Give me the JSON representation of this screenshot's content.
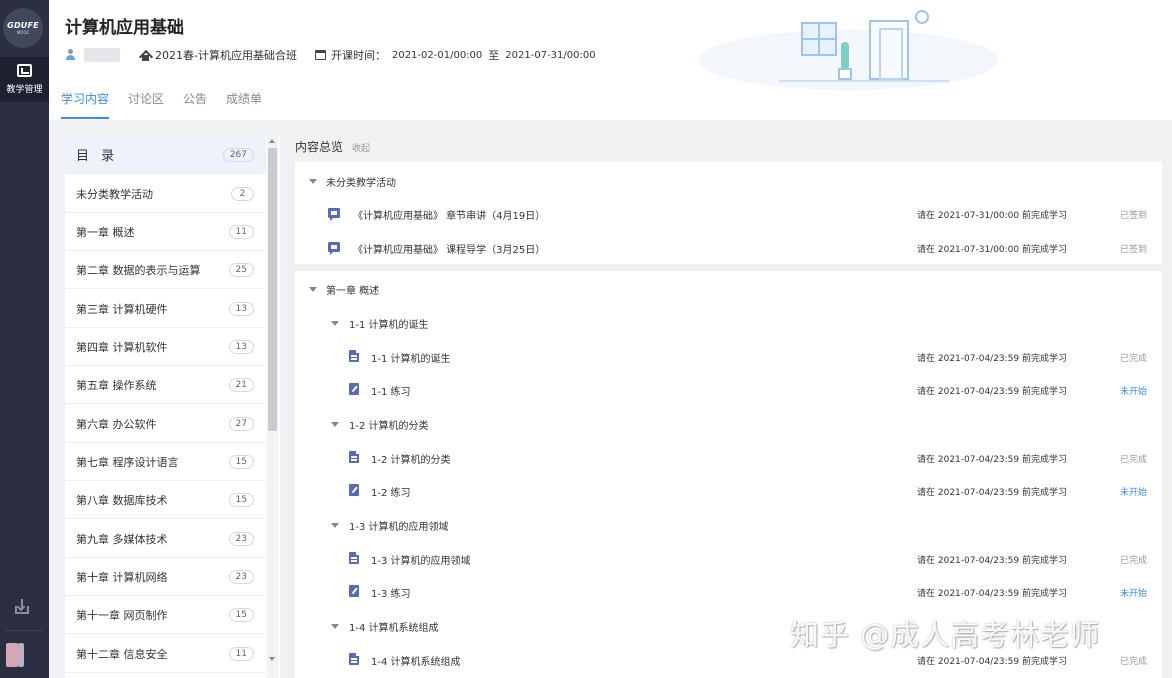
{
  "rail": {
    "logo_main": "GDUFE",
    "logo_sub": "MOOC",
    "active_label": "教学管理"
  },
  "header": {
    "course_title": "计算机应用基础",
    "class_name": "2021春-计算机应用基础合班",
    "time_label": "开课时间：",
    "start": "2021-02-01/00:00",
    "to": "至",
    "end": "2021-07-31/00:00"
  },
  "tabs": [
    {
      "label": "学习内容",
      "active": true
    },
    {
      "label": "讨论区"
    },
    {
      "label": "公告"
    },
    {
      "label": "成绩单"
    }
  ],
  "catalog": {
    "title": "目 录",
    "title_count": "267",
    "items": [
      {
        "name": "未分类教学活动",
        "count": "2"
      },
      {
        "name": "第一章 概述",
        "count": "11"
      },
      {
        "name": "第二章 数据的表示与运算",
        "count": "25"
      },
      {
        "name": "第三章 计算机硬件",
        "count": "13"
      },
      {
        "name": "第四章 计算机软件",
        "count": "13"
      },
      {
        "name": "第五章 操作系统",
        "count": "21"
      },
      {
        "name": "第六章 办公软件",
        "count": "27"
      },
      {
        "name": "第七章 程序设计语言",
        "count": "15"
      },
      {
        "name": "第八章 数据库技术",
        "count": "15"
      },
      {
        "name": "第九章 多媒体技术",
        "count": "23"
      },
      {
        "name": "第十章 计算机网络",
        "count": "23"
      },
      {
        "name": "第十一章 网页制作",
        "count": "15"
      },
      {
        "name": "第十二章 信息安全",
        "count": "11"
      }
    ]
  },
  "overview": {
    "title": "内容总览",
    "collapse": "收起"
  },
  "section_uncategorized": {
    "title": "未分类教学活动",
    "items": [
      {
        "icon": "chat",
        "title": "《计算机应用基础》 章节串讲（4月19日）",
        "deadline": "请在 2021-07-31/00:00 前完成学习",
        "status": "已签到"
      },
      {
        "icon": "chat",
        "title": "《计算机应用基础》 课程导学（3月25日）",
        "deadline": "请在 2021-07-31/00:00 前完成学习",
        "status": "已签到"
      }
    ]
  },
  "section_ch1": {
    "title": "第一章 概述",
    "subsections": [
      {
        "title": "1-1 计算机的诞生",
        "items": [
          {
            "icon": "doc",
            "title": "1-1 计算机的诞生",
            "deadline": "请在 2021-07-04/23:59 前完成学习",
            "status": "已完成"
          },
          {
            "icon": "edit",
            "title": "1-1 练习",
            "deadline": "请在 2021-07-04/23:59 前完成学习",
            "status": "未开始"
          }
        ]
      },
      {
        "title": "1-2 计算机的分类",
        "items": [
          {
            "icon": "doc",
            "title": "1-2 计算机的分类",
            "deadline": "请在 2021-07-04/23:59 前完成学习",
            "status": "已完成"
          },
          {
            "icon": "edit",
            "title": "1-2 练习",
            "deadline": "请在 2021-07-04/23:59 前完成学习",
            "status": "未开始"
          }
        ]
      },
      {
        "title": "1-3 计算机的应用领域",
        "items": [
          {
            "icon": "doc",
            "title": "1-3 计算机的应用领域",
            "deadline": "请在 2021-07-04/23:59 前完成学习",
            "status": "已完成"
          },
          {
            "icon": "edit",
            "title": "1-3 练习",
            "deadline": "请在 2021-07-04/23:59 前完成学习",
            "status": "未开始"
          }
        ]
      },
      {
        "title": "1-4 计算机系统组成",
        "items": [
          {
            "icon": "doc",
            "title": "1-4 计算机系统组成",
            "deadline": "请在 2021-07-04/23:59 前完成学习",
            "status": "已完成"
          }
        ]
      }
    ]
  },
  "watermark": "知乎 @成人高考林老师",
  "colors": {
    "accent": "#3a8ee6",
    "rail": "#2b2f3f",
    "icon": "#5a6ab8"
  }
}
